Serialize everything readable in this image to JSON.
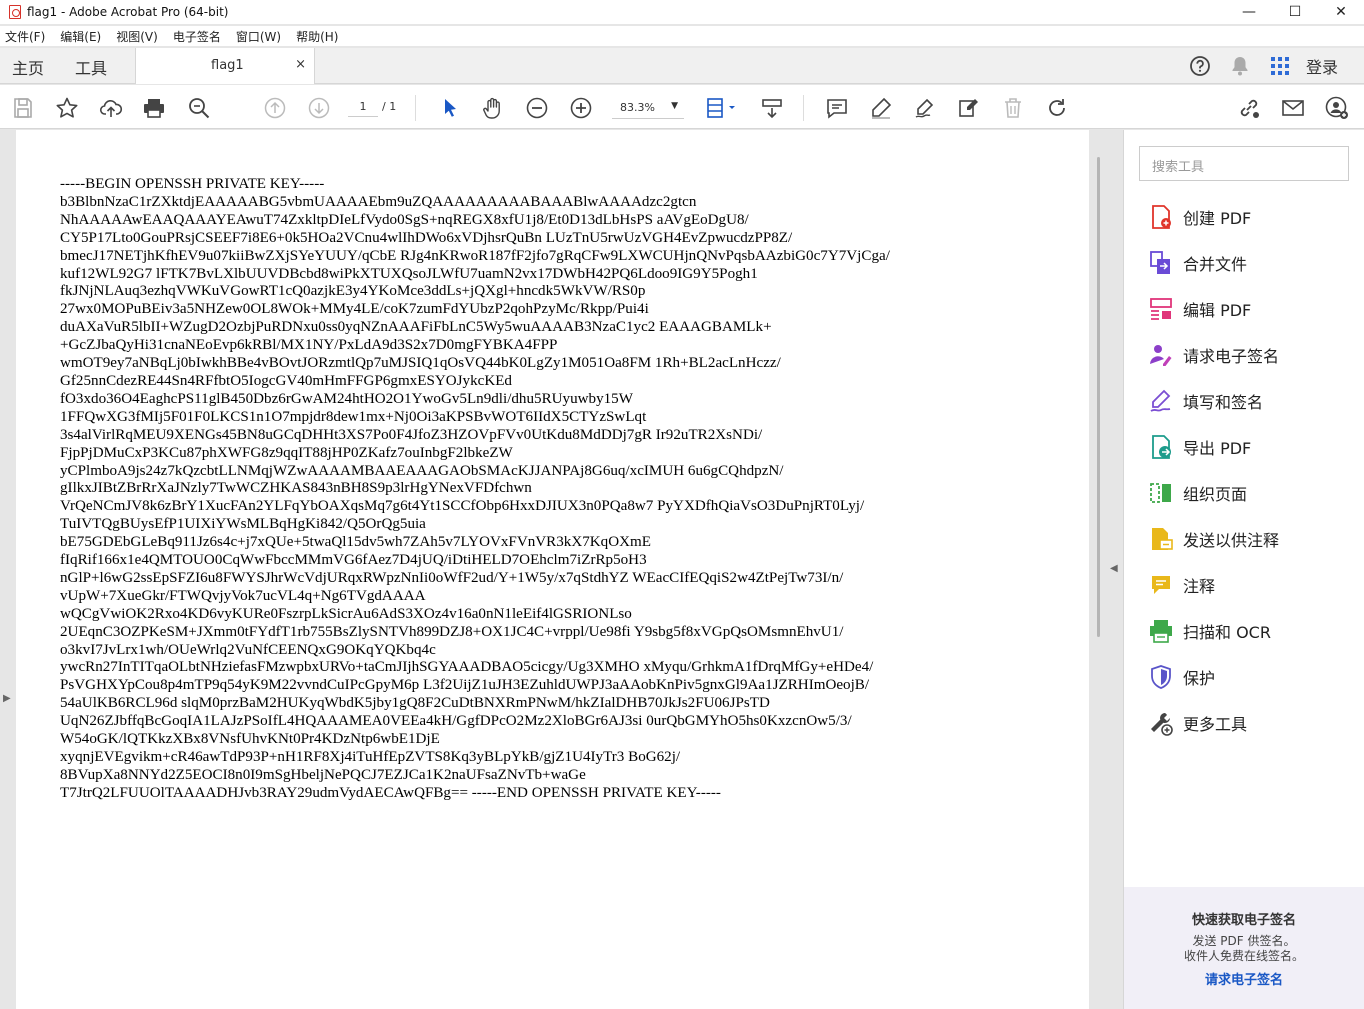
{
  "window": {
    "title": "flag1 - Adobe Acrobat Pro (64-bit)",
    "minimize": "—",
    "maximize": "☐",
    "close": "✕"
  },
  "menu": [
    "文件(F)",
    "编辑(E)",
    "视图(V)",
    "电子签名",
    "窗口(W)",
    "帮助(H)"
  ],
  "tabs": {
    "home": "主页",
    "tools": "工具",
    "doc": "flag1",
    "doc_close": "×",
    "login": "登录"
  },
  "toolbar": {
    "page_current": "1",
    "page_total": "/ 1",
    "zoom": "83.3%"
  },
  "document": {
    "lines": [
      "-----BEGIN OPENSSH PRIVATE KEY-----",
      "b3BlbnNzaC1rZXktdjEAAAAABG5vbmUAAAAEbm9uZQAAAAAAAAABAAABlwAAAAdzc2gtcn",
      "NhAAAAAwEAAQAAAYEAwuT74ZxkltpDIeLfVydo0SgS+nqREGX8xfU1j8/Et0D13dLbHsPS aAVgEoDgU8/",
      "CY5P17Lto0GouPRsjCSEEF7i8E6+0k5HOa2VCnu4wlIhDWo6xVDjhsrQuBn LUzTnU5rwUzVGH4EvZpwucdzPP8Z/",
      "bmecJ17NETjhKfhEV9u07kiiBwZXjSYeYUUY/qCbE RJg4nKRwoR187fF2jfo7gRqCFw9LXWCUHjnQNvPqsbAAzbiG0c7Y7VjCga/",
      "kuf12WL92G7 lFTK7BvLXlbUUVDBcbd8wiPkXTUXQsoJLWfU7uamN2vx17DWbH42PQ6Ldoo9IG9Y5Pogh1",
      "fkJNjNLAuq3ezhqVWKuVGowRT1cQ0azjkE3y4YKoMce3ddLs+jQXgl+hncdk5WkVW/RS0p",
      "27wx0MOPuBEiv3a5NHZew0OL8WOk+MMy4LE/coK7zumFdYUbzP2qohPzyMc/Rkpp/Pui4i",
      "duAXaVuR5lbII+WZugD2OzbjPuRDNxu0ss0yqNZnAAAFiFbLnC5Wy5wuAAAAB3NzaC1yc2 EAAAGBAMLk+",
      "+GcZJbaQyHi31cnaNEoEvp6kRBl/MX1NY/PxLdA9d3S2x7D0mgFYBKA4FPP",
      "wmOT9ey7aNBqLj0bIwkhBBe4vBOvtJORzmtlQp7uMJSIQ1qOsVQ44bK0LgZy1M051Oa8FM 1Rh+BL2acLnHczz/",
      "Gf25nnCdezRE44Sn4RFfbtO5IogcGV40mHmFFGP6gmxESYOJykcKEd",
      "fO3xdo36O4EaghcPS11glB450Dbz6rGwAM24htHO2O1YwoGv5Ln9dli/dhu5RUyuwby15W",
      "1FFQwXG3fMIj5F01F0LKCS1n1O7mpjdr8dew1mx+Nj0Oi3aKPSBvWOT6IIdX5CTYzSwLqt",
      "3s4alVirlRqMEU9XENGs45BN8uGCqDHHt3XS7Po0F4JfoZ3HZOVpFVv0UtKdu8MdDDj7gR Ir92uTR2XsNDi/",
      "FjpPjDMuCxP3KCu87phXWFG8z9qqIT88jHP0ZKafz7ouInbgF2lbkeZW",
      "yCPlmboA9js24z7kQzcbtLLNMqjWZwAAAAMBAAEAAAGAObSMAcKJJANPAj8G6uq/xcIMUH 6u6gCQhdpzN/",
      "gIlkxJIBtZBrRrXaJNzly7TwWCZHKAS843nBH8S9p3lrHgYNexVFDfchwn",
      "VrQeNCmJV8k6zBrY1XucFAn2YLFqYbOAXqsMq7g6t4Yt1SCCfObp6HxxDJIUX3n0PQa8w7 PyYXDfhQiaVsO3DuPnjRT0Lyj/",
      "TuIVTQgBUysEfP1UIXiYWsMLBqHgKi842/Q5OrQg5uia",
      "bE75GDEbGLeBq911Jz6s4c+j7xQUe+5twaQl15dv5wh7ZAh5v7LYOVxFVnVR3kX7KqOXmE",
      "fIqRif166x1e4QMTOUO0CqWwFbccMMmVG6fAez7D4jUQ/iDtiHELD7OEhclm7iZrRp5oH3",
      "nGlP+l6wG2ssEpSFZI6u8FWYSJhrWcVdjURqxRWpzNnIi0oWfF2ud/Y+1W5y/x7qStdhYZ WEacCIfEQqiS2w4ZtPejTw73I/n/",
      "vUpW+7XueGkr/FTWQvjyVok7ucVL4q+Ng6TVgdAAAA",
      "wQCgVwiOK2Rxo4KD6vyKURe0FszrpLkSicrAu6AdS3XOz4v16a0nN1leEif4lGSRIONLso",
      "2UEqnC3OZPKeSM+JXmm0tFYdfT1rb755BsZlySNTVh899DZJ8+OX1JC4C+vrppl/Ue98fi Y9sbg5f8xVGpQsOMsmnEhvU1/",
      "o3kvI7JvLrx1wh/OUeWrlq2VuNfCEENQxG9OKqYQKbq4c",
      "ywcRn27InTITqaOLbtNHziefasFMzwpbxURVo+taCmJIjhSGYAAADBAO5cicgy/Ug3XMHO xMyqu/GrhkmA1fDrqMfGy+eHDe4/",
      "PsVGHXYpCou8p4mTP9q54yK9M22vvndCuIPcGpyM6p L3f2UijZ1uJH3EZuhldUWPJ3aAAobKnPiv5gnxGl9Aa1JZRHImOeojB/",
      "54aUlKB6RCL96d slqM0przBaM2HUKyqWbdK5jby1gQ8F2CuDtBNXRmPNwM/hkZIalDHB70JkJs2FU06JPsTD",
      "UqN26ZJbffqBcGoqIA1LAJzPSoIfL4HQAAAMEA0VEEa4kH/GgfDPcO2Mz2XloBGr6AJ3si 0urQbGMYhO5hs0KxzcnOw5/3/",
      "W54oGK/lQTKkzXBx8VNsfUhvKNt0Pr4KDzNtp6wbE1DjE",
      "xyqnjEVEgvikm+cR46awTdP93P+nH1RF8Xj4iTuHfEpZVTS8Kq3yBLpYkB/gjZ1U4IyTr3 BoG62j/",
      "8BVupXa8NNYd2Z5EOCI8n0I9mSgHbeljNePQCJ7EZJCa1K2naUFsaZNvTb+waGe",
      "T7JtrQ2LFUUOlTAAAADHJvb3RAY29udmVydAECAwQFBg== -----END OPENSSH PRIVATE KEY-----"
    ]
  },
  "panel": {
    "search_placeholder": "搜索工具",
    "tools": [
      {
        "label": "创建 PDF",
        "icon": "create-pdf-icon",
        "color": "#e0352b"
      },
      {
        "label": "合并文件",
        "icon": "combine-files-icon",
        "color": "#6a4bd6"
      },
      {
        "label": "编辑 PDF",
        "icon": "edit-pdf-icon",
        "color": "#e0357a"
      },
      {
        "label": "请求电子签名",
        "icon": "request-esign-icon",
        "color": "#8c3fc9"
      },
      {
        "label": "填写和签名",
        "icon": "fill-sign-icon",
        "color": "#7b4fd3"
      },
      {
        "label": "导出 PDF",
        "icon": "export-pdf-icon",
        "color": "#1d9c8c"
      },
      {
        "label": "组织页面",
        "icon": "organize-pages-icon",
        "color": "#3ea84a"
      },
      {
        "label": "发送以供注释",
        "icon": "send-comments-icon",
        "color": "#e9b81a"
      },
      {
        "label": "注释",
        "icon": "comment-icon",
        "color": "#e9b81a"
      },
      {
        "label": "扫描和 OCR",
        "icon": "scan-ocr-icon",
        "color": "#3ea84a"
      },
      {
        "label": "保护",
        "icon": "protect-icon",
        "color": "#5a55c9"
      },
      {
        "label": "更多工具",
        "icon": "more-tools-icon",
        "color": "#444444"
      }
    ],
    "promo": {
      "heading": "快速获取电子签名",
      "line1": "发送 PDF 供签名。",
      "line2": "收件人免费在线签名。",
      "link": "请求电子签名"
    }
  }
}
